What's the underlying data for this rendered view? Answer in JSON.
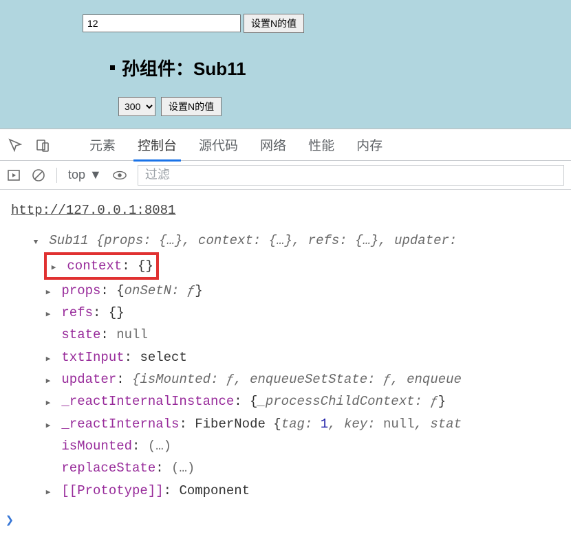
{
  "app": {
    "input_value": "12",
    "btn_set_n": "设置N的值",
    "heading": "孙组件：Sub11",
    "select_value": "300",
    "btn_set_n2": "设置N的值"
  },
  "devtools": {
    "tabs": {
      "elements": "元素",
      "console": "控制台",
      "sources": "源代码",
      "network": "网络",
      "performance": "性能",
      "memory": "内存"
    },
    "toolbar": {
      "context": "top",
      "filter_placeholder": "过滤"
    },
    "origin_url": "http://127.0.0.1:8081"
  },
  "obj": {
    "class_name": "Sub11",
    "root_preview": " {props: {…}, context: {…}, refs: {…}, updater: ",
    "props": {
      "context": {
        "k": "context",
        "v": "{}"
      },
      "props_line": {
        "k": "props",
        "preview_k": "onSetN",
        "preview_v": "ƒ"
      },
      "refs": {
        "k": "refs",
        "v": "{}"
      },
      "state": {
        "k": "state",
        "v": "null"
      },
      "txtInput": {
        "k": "txtInput",
        "v": "select"
      },
      "updater": {
        "k": "updater",
        "preview": "{isMounted: ƒ, enqueueSetState: ƒ, enqueue"
      },
      "rii": {
        "k": "_reactInternalInstance",
        "preview_k": "_processChildContext",
        "preview_v": "ƒ"
      },
      "ri": {
        "k": "_reactInternals",
        "cls": "FiberNode",
        "tag_k": "tag",
        "tag_v": "1",
        "key_k": "key",
        "key_v": "null",
        "tail": ", stat"
      },
      "isMounted": {
        "k": "isMounted",
        "v": "(…)"
      },
      "replaceState": {
        "k": "replaceState",
        "v": "(…)"
      },
      "proto": {
        "k": "[[Prototype]]",
        "v": "Component"
      }
    },
    "prompt": "❯"
  }
}
